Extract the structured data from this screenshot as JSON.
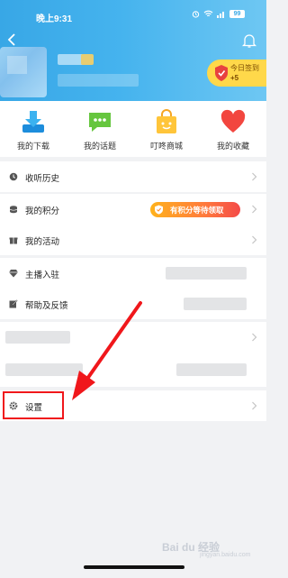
{
  "status_bar": {
    "time": "晚上9:31",
    "battery": "99"
  },
  "header": {
    "signin_line1": "今日签到",
    "signin_line2": "+5"
  },
  "quick_actions": [
    {
      "label": "我的下载",
      "icon": "download-icon"
    },
    {
      "label": "我的话题",
      "icon": "chat-icon"
    },
    {
      "label": "叮咚商城",
      "icon": "shopping-bag-icon"
    },
    {
      "label": "我的收藏",
      "icon": "heart-icon"
    }
  ],
  "menu": {
    "history": "收听历史",
    "points": "我的积分",
    "points_badge": "有积分等待领取",
    "activities": "我的活动",
    "anchor": "主播入驻",
    "help": "帮助及反馈",
    "settings": "设置"
  },
  "watermark": {
    "brand": "Bai du 经验",
    "url": "jingyan.baidu.com"
  },
  "colors": {
    "header": "#3aa9e6",
    "badge": "#ff7a3c",
    "annotation": "#f0171b"
  }
}
